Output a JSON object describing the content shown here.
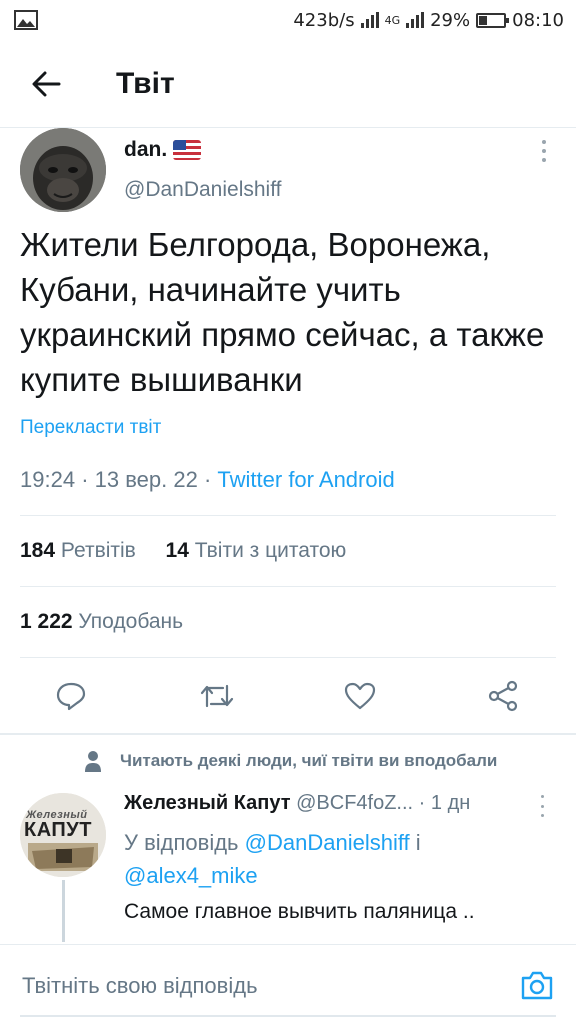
{
  "status_bar": {
    "speed": "423b/s",
    "network": "4G",
    "battery": "29%",
    "battery_level": 0.29,
    "time": "08:10"
  },
  "app_bar": {
    "title": "Твіт"
  },
  "tweet": {
    "author_name": "dan.",
    "author_handle": "@DanDanielshiff",
    "text": "Жители Белгорода, Воронежа, Кубани, начинайте учить украинский прямо сейчас, а также купите вышиванки",
    "translate": "Перекласти твіт",
    "time": "19:24",
    "date": "13 вер. 22",
    "source": "Twitter for Android",
    "retweets_count": "184",
    "retweets_label": "Ретвітів",
    "quotes_count": "14",
    "quotes_label": "Твіти з цитатою",
    "likes_count": "1 222",
    "likes_label": "Уподобань"
  },
  "social_context": "Читають деякі люди, чиї твіти ви вподобали",
  "reply": {
    "author_name": "Железный Капут",
    "author_handle": "@BCF4foZ...",
    "age": "1 дн",
    "reply_to_prefix": "У відповідь",
    "reply_to_user1": "@DanDanielshiff",
    "reply_to_joiner": "і",
    "reply_to_user2": "@alex4_mike",
    "text": "Самое главное вывчить паляница ..",
    "avatar_logo_line1": "Железный",
    "avatar_logo_line2": "КАПУТ"
  },
  "compose": {
    "placeholder": "Твітніть свою відповідь"
  },
  "colors": {
    "accent": "#1da1f2",
    "text": "#14171a",
    "muted": "#657786",
    "divider": "#e6ecf0"
  }
}
